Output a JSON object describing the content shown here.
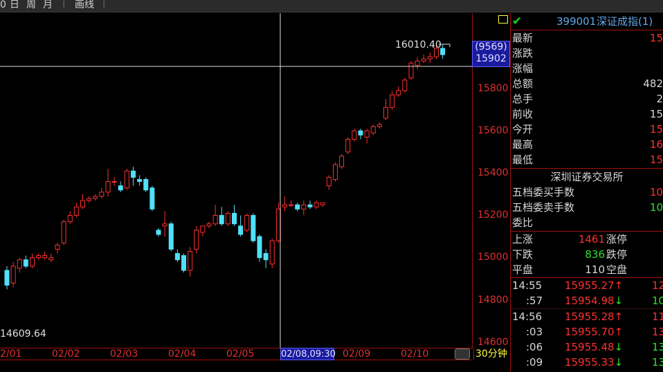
{
  "toolbar": {
    "items": [
      "0",
      "日",
      "周",
      "月",
      "⁝",
      "画线",
      "⁝"
    ]
  },
  "chart": {
    "y_axis_labels": [
      "15800",
      "15600",
      "15400",
      "15200",
      "15000",
      "14800",
      "14600"
    ],
    "crosshair_value_top": "(9569)",
    "crosshair_value_bottom": "15902",
    "max_label": "16010.40",
    "min_label": "14609.64",
    "x_axis_labels": [
      "2/01",
      "02/02",
      "02/03",
      "02/04",
      "02/05",
      "02/09",
      "02/10"
    ],
    "x_cursor_label": "02/08,09:30",
    "period": "30分钟",
    "colors": {
      "up": "#ff3030",
      "down": "#50e0f8",
      "axis": "#a01010",
      "cross": "#e0e0e0"
    }
  },
  "chart_data": {
    "type": "candlestick",
    "ylim": [
      14560,
      16050
    ],
    "candles": [
      {
        "o": 14940,
        "c": 14870,
        "h": 14960,
        "l": 14850
      },
      {
        "o": 14880,
        "c": 14960,
        "h": 14980,
        "l": 14860
      },
      {
        "o": 14950,
        "c": 14990,
        "h": 15000,
        "l": 14930
      },
      {
        "o": 14990,
        "c": 14960,
        "h": 15010,
        "l": 14950
      },
      {
        "o": 14960,
        "c": 15000,
        "h": 15020,
        "l": 14950
      },
      {
        "o": 15000,
        "c": 15010,
        "h": 15020,
        "l": 14990
      },
      {
        "o": 15000,
        "c": 15010,
        "h": 15030,
        "l": 14990
      },
      {
        "o": 14990,
        "c": 15000,
        "h": 15020,
        "l": 14980
      },
      {
        "o": 15040,
        "c": 15060,
        "h": 15070,
        "l": 15020
      },
      {
        "o": 15070,
        "c": 15170,
        "h": 15180,
        "l": 15060
      },
      {
        "o": 15170,
        "c": 15200,
        "h": 15220,
        "l": 15160
      },
      {
        "o": 15200,
        "c": 15240,
        "h": 15260,
        "l": 15190
      },
      {
        "o": 15240,
        "c": 15270,
        "h": 15300,
        "l": 15230
      },
      {
        "o": 15270,
        "c": 15280,
        "h": 15290,
        "l": 15260
      },
      {
        "o": 15280,
        "c": 15290,
        "h": 15300,
        "l": 15270
      },
      {
        "o": 15290,
        "c": 15310,
        "h": 15330,
        "l": 15280
      },
      {
        "o": 15310,
        "c": 15360,
        "h": 15420,
        "l": 15290
      },
      {
        "o": 15360,
        "c": 15360,
        "h": 15380,
        "l": 15340
      },
      {
        "o": 15340,
        "c": 15320,
        "h": 15360,
        "l": 15310
      },
      {
        "o": 15330,
        "c": 15410,
        "h": 15420,
        "l": 15320
      },
      {
        "o": 15410,
        "c": 15380,
        "h": 15430,
        "l": 15340
      },
      {
        "o": 15370,
        "c": 15360,
        "h": 15390,
        "l": 15340
      },
      {
        "o": 15370,
        "c": 15320,
        "h": 15380,
        "l": 15310
      },
      {
        "o": 15330,
        "c": 15230,
        "h": 15340,
        "l": 15220
      },
      {
        "o": 15130,
        "c": 15110,
        "h": 15140,
        "l": 15100
      },
      {
        "o": 15150,
        "c": 15160,
        "h": 15220,
        "l": 15100
      },
      {
        "o": 15160,
        "c": 15040,
        "h": 15170,
        "l": 15030
      },
      {
        "o": 15020,
        "c": 14990,
        "h": 15040,
        "l": 14980
      },
      {
        "o": 15010,
        "c": 14940,
        "h": 15020,
        "l": 14930
      },
      {
        "o": 14940,
        "c": 15030,
        "h": 15050,
        "l": 14910
      },
      {
        "o": 15040,
        "c": 15130,
        "h": 15150,
        "l": 15020
      },
      {
        "o": 15120,
        "c": 15150,
        "h": 15150,
        "l": 15100
      },
      {
        "o": 15150,
        "c": 15160,
        "h": 15170,
        "l": 15140
      },
      {
        "o": 15160,
        "c": 15200,
        "h": 15250,
        "l": 15150
      },
      {
        "o": 15200,
        "c": 15160,
        "h": 15240,
        "l": 15150
      },
      {
        "o": 15160,
        "c": 15210,
        "h": 15220,
        "l": 15150
      },
      {
        "o": 15210,
        "c": 15160,
        "h": 15250,
        "l": 15150
      },
      {
        "o": 15150,
        "c": 15110,
        "h": 15200,
        "l": 15100
      },
      {
        "o": 15130,
        "c": 15200,
        "h": 15210,
        "l": 15120
      },
      {
        "o": 15200,
        "c": 15080,
        "h": 15210,
        "l": 15070
      },
      {
        "o": 15100,
        "c": 15000,
        "h": 15110,
        "l": 14980
      },
      {
        "o": 15020,
        "c": 14990,
        "h": 15040,
        "l": 14950
      },
      {
        "o": 14970,
        "c": 15080,
        "h": 15090,
        "l": 14950
      },
      {
        "o": 15080,
        "c": 15230,
        "h": 15260,
        "l": 15070
      },
      {
        "o": 15240,
        "c": 15250,
        "h": 15290,
        "l": 15220
      },
      {
        "o": 15250,
        "c": 15250,
        "h": 15270,
        "l": 15240
      },
      {
        "o": 15250,
        "c": 15230,
        "h": 15260,
        "l": 15220
      },
      {
        "o": 15230,
        "c": 15250,
        "h": 15270,
        "l": 15200
      },
      {
        "o": 15250,
        "c": 15240,
        "h": 15270,
        "l": 15230
      },
      {
        "o": 15240,
        "c": 15260,
        "h": 15270,
        "l": 15230
      },
      {
        "o": 15250,
        "c": 15260,
        "h": 15260,
        "l": 15240
      },
      {
        "o": 15340,
        "c": 15380,
        "h": 15390,
        "l": 15320
      },
      {
        "o": 15370,
        "c": 15440,
        "h": 15450,
        "l": 15360
      },
      {
        "o": 15430,
        "c": 15480,
        "h": 15490,
        "l": 15420
      },
      {
        "o": 15500,
        "c": 15560,
        "h": 15570,
        "l": 15490
      },
      {
        "o": 15560,
        "c": 15600,
        "h": 15610,
        "l": 15550
      },
      {
        "o": 15600,
        "c": 15580,
        "h": 15610,
        "l": 15560
      },
      {
        "o": 15570,
        "c": 15600,
        "h": 15610,
        "l": 15540
      },
      {
        "o": 15590,
        "c": 15620,
        "h": 15630,
        "l": 15580
      },
      {
        "o": 15620,
        "c": 15630,
        "h": 15640,
        "l": 15610
      },
      {
        "o": 15660,
        "c": 15710,
        "h": 15750,
        "l": 15650
      },
      {
        "o": 15710,
        "c": 15770,
        "h": 15790,
        "l": 15700
      },
      {
        "o": 15770,
        "c": 15790,
        "h": 15810,
        "l": 15760
      },
      {
        "o": 15790,
        "c": 15840,
        "h": 15850,
        "l": 15780
      },
      {
        "o": 15850,
        "c": 15920,
        "h": 15930,
        "l": 15840
      },
      {
        "o": 15910,
        "c": 15930,
        "h": 15950,
        "l": 15890
      },
      {
        "o": 15930,
        "c": 15940,
        "h": 15960,
        "l": 15920
      },
      {
        "o": 15940,
        "c": 15950,
        "h": 15970,
        "l": 15920
      },
      {
        "o": 15950,
        "c": 15990,
        "h": 16010,
        "l": 15940
      },
      {
        "o": 15990,
        "c": 15960,
        "h": 16010,
        "l": 15940
      }
    ]
  },
  "panel": {
    "code": "399001",
    "name": "深证成指(1)",
    "fields": [
      {
        "label": "最新",
        "value": "15"
      },
      {
        "label": "涨跌",
        "value": ""
      },
      {
        "label": "涨幅",
        "value": ""
      },
      {
        "label": "总额",
        "value": "482"
      },
      {
        "label": "总手",
        "value": "2"
      },
      {
        "label": "前收",
        "value": "15"
      },
      {
        "label": "今开",
        "value": "15"
      },
      {
        "label": "最高",
        "value": "16"
      },
      {
        "label": "最低",
        "value": "15"
      }
    ],
    "exchange_title": "深圳证券交易所",
    "queue": [
      {
        "label": "五档委买手数",
        "value": "10"
      },
      {
        "label": "五档委卖手数",
        "value": "10"
      },
      {
        "label": "委比",
        "value": ""
      }
    ],
    "stats": [
      {
        "l1": "上涨",
        "n": "1461",
        "l2": "涨停",
        "color": "#ff3030"
      },
      {
        "l1": "下跌",
        "n": "836",
        "l2": "跌停",
        "color": "#30e030"
      },
      {
        "l1": "平盘",
        "n": "110",
        "l2": "空盘",
        "color": "#d8d8d8"
      }
    ],
    "ticks": [
      {
        "time": "14:55",
        "price": "15955.27↑",
        "vol": "12",
        "pc": "#ff3030",
        "vc": "#ff3030"
      },
      {
        "time": ":57",
        "price": "15954.98↓",
        "vol": "10",
        "pc": "#ff3030",
        "vc": "#30e030"
      },
      {
        "time": "14:56",
        "price": "15955.28↑",
        "vol": "11",
        "pc": "#ff3030",
        "vc": "#ff3030"
      },
      {
        "time": ":03",
        "price": "15955.70↑",
        "vol": "13",
        "pc": "#ff3030",
        "vc": "#ff3030"
      },
      {
        "time": ":06",
        "price": "15955.48↓",
        "vol": "13",
        "pc": "#ff3030",
        "vc": "#30e030"
      },
      {
        "time": ":09",
        "price": "15955.33↓",
        "vol": "13",
        "pc": "#ff3030",
        "vc": "#30e030"
      }
    ]
  }
}
